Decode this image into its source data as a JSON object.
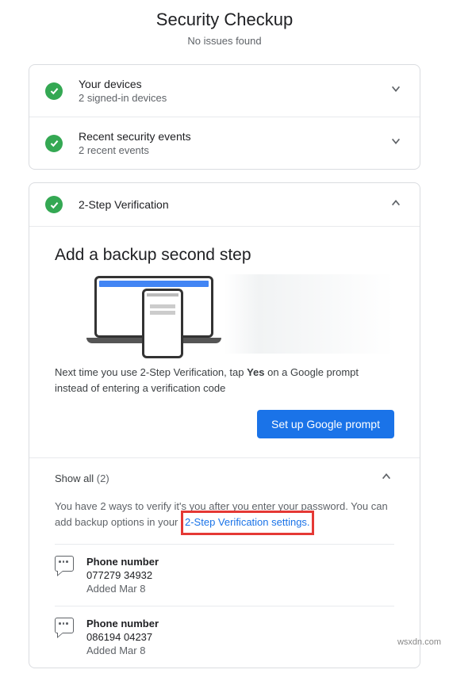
{
  "header": {
    "title": "Security Checkup",
    "subtitle": "No issues found"
  },
  "sections": {
    "devices": {
      "title": "Your devices",
      "subtitle": "2 signed-in devices"
    },
    "events": {
      "title": "Recent security events",
      "subtitle": "2 recent events"
    },
    "twostep": {
      "title": "2-Step Verification",
      "panel_heading": "Add a backup second step",
      "desc_pre": "Next time you use 2-Step Verification, tap ",
      "desc_bold": "Yes",
      "desc_post": " on a Google prompt instead of entering a verification code",
      "button": "Set up Google prompt",
      "showall_label": "Show all",
      "showall_count": "(2)",
      "info_pre": "You have 2 ways to verify it's you after you enter your password. You can add backup options in your ",
      "info_link": "2-Step Verification settings.",
      "methods": [
        {
          "title": "Phone number",
          "value": "077279 34932",
          "added": "Added Mar 8"
        },
        {
          "title": "Phone number",
          "value": "086194 04237",
          "added": "Added Mar 8"
        }
      ]
    }
  },
  "watermark": "wsxdn.com"
}
